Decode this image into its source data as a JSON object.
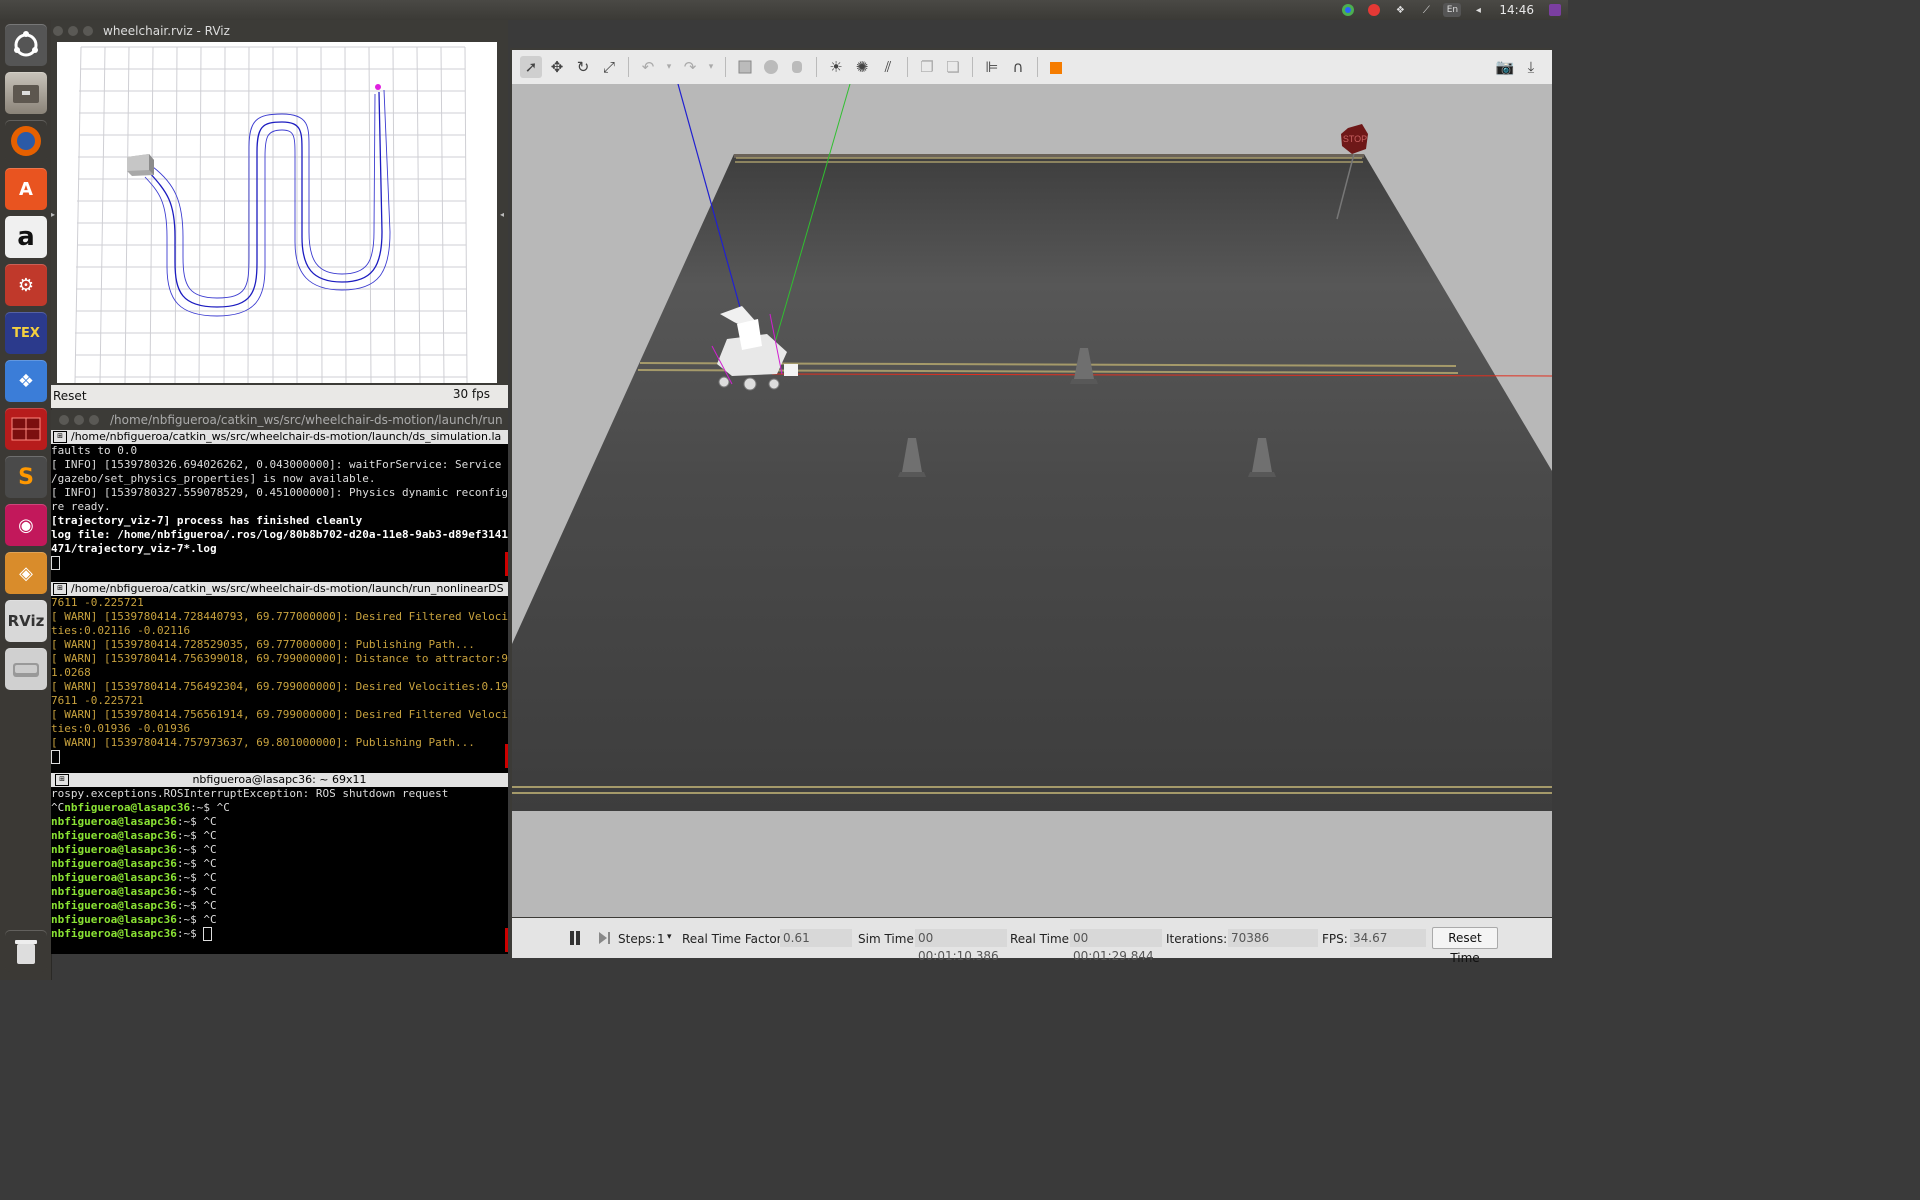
{
  "top_panel": {
    "clock": "14:46",
    "keyboard_layout": "En",
    "tray_icons": [
      "chrome-icon",
      "record-icon",
      "dropbox-icon",
      "network-icon",
      "keyboard-icon",
      "volume-icon",
      "session-icon"
    ]
  },
  "launcher": {
    "items": [
      "ubuntu-dash-icon",
      "files-icon",
      "firefox-icon",
      "software-center-icon",
      "amazon-icon",
      "system-settings-icon",
      "texmaker-icon",
      "dropbox-icon",
      "terminator-icon",
      "sublime-text-icon",
      "robotics-app-icon",
      "blender-icon",
      "rviz-icon",
      "disk-icon",
      "trash-icon"
    ],
    "texmaker_label": "TEX",
    "rviz_label": "RViz",
    "sublime_label": "S",
    "amazon_label": "a"
  },
  "rviz": {
    "title": "wheelchair.rviz - RViz",
    "reset_label": "Reset",
    "fps_label": "30 fps"
  },
  "terminal": {
    "window_title": "/home/nbfigueroa/catkin_ws/src/wheelchair-ds-motion/launch/run",
    "pane1": {
      "header": "/home/nbfigueroa/catkin_ws/src/wheelchair-ds-motion/launch/ds_simulation.la",
      "lines": [
        {
          "text": "faults to 0.0",
          "style": "normal"
        },
        {
          "text": "[ INFO] [1539780326.694026262, 0.043000000]: waitForService: Service",
          "style": "normal"
        },
        {
          "text": "/gazebo/set_physics_properties] is now available.",
          "style": "normal"
        },
        {
          "text": "[ INFO] [1539780327.559078529, 0.451000000]: Physics dynamic reconfig",
          "style": "normal"
        },
        {
          "text": "re ready.",
          "style": "normal"
        },
        {
          "text": "[trajectory_viz-7] process has finished cleanly",
          "style": "bold"
        },
        {
          "text": "log file: /home/nbfigueroa/.ros/log/80b8b702-d20a-11e8-9ab3-d89ef3141",
          "style": "bold"
        },
        {
          "text": "471/trajectory_viz-7*.log",
          "style": "bold"
        }
      ]
    },
    "pane2": {
      "header": "/home/nbfigueroa/catkin_ws/src/wheelchair-ds-motion/launch/run_nonlinearDS",
      "lines": [
        {
          "text": "7611 -0.225721",
          "style": "warn"
        },
        {
          "text": "[ WARN] [1539780414.728440793, 69.777000000]: Desired Filtered Veloci",
          "style": "warn"
        },
        {
          "text": "ties:0.02116 -0.02116",
          "style": "warn"
        },
        {
          "text": "[ WARN] [1539780414.728529035, 69.777000000]: Publishing Path...",
          "style": "warn"
        },
        {
          "text": "[ WARN] [1539780414.756399018, 69.799000000]: Distance to attractor:9",
          "style": "warn"
        },
        {
          "text": "1.0268",
          "style": "warn"
        },
        {
          "text": "[ WARN] [1539780414.756492304, 69.799000000]: Desired Velocities:0.19",
          "style": "warn"
        },
        {
          "text": "7611 -0.225721",
          "style": "warn"
        },
        {
          "text": "[ WARN] [1539780414.756561914, 69.799000000]: Desired Filtered Veloci",
          "style": "warn"
        },
        {
          "text": "ties:0.01936 -0.01936",
          "style": "warn"
        },
        {
          "text": "[ WARN] [1539780414.757973637, 69.801000000]: Publishing Path...",
          "style": "warn"
        }
      ]
    },
    "pane3": {
      "header": "nbfigueroa@lasapc36: ~ 69x11",
      "line1": "rospy.exceptions.ROSInterruptException: ROS shutdown request",
      "line2_prefix": "^C",
      "prompt": "nbfigueroa@lasapc36",
      "path_suffix": ":~$ ",
      "cmd": "^C",
      "repeat_count_lines": [
        "^C",
        "^C",
        "^C",
        "^C",
        "^C",
        "^C",
        "^C",
        "^C"
      ]
    }
  },
  "gazebo": {
    "stop_sign_text": "STOP",
    "bottom_bar": {
      "steps_label": "Steps:",
      "steps_value": "1",
      "rtf_label": "Real Time Factor:",
      "rtf_value": "0.61",
      "sim_time_label": "Sim Time:",
      "sim_time_value": "00 00:01:10.386",
      "real_time_label": "Real Time:",
      "real_time_value": "00 00:01:29.844",
      "iterations_label": "Iterations:",
      "iterations_value": "70386",
      "fps_label": "FPS:",
      "fps_value": "34.67",
      "reset_time_label": "Reset Time"
    }
  }
}
